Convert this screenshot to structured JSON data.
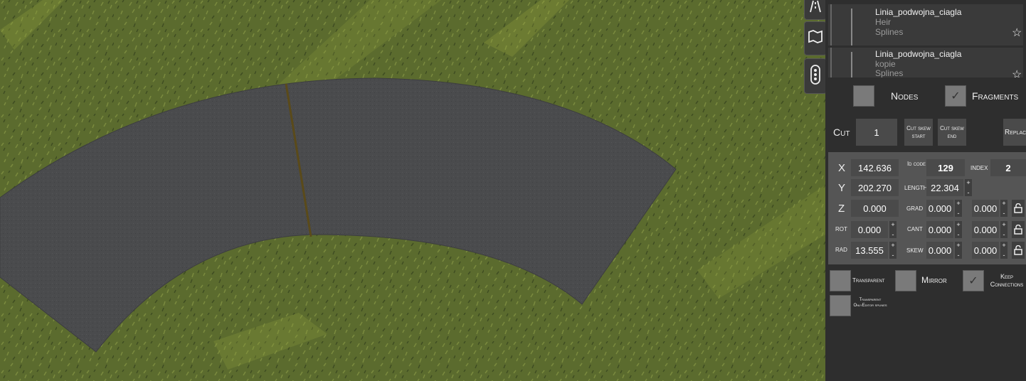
{
  "colors": {
    "asphalt": "#4a4b4d",
    "grass": "#5f6e30",
    "panel": "#2e2e2e",
    "field": "#4a4a4a",
    "center_line": "#5a4a1a"
  },
  "list": [
    {
      "title": "Linia_podwojna_ciagla",
      "sub1": "Heir",
      "sub2": "Splines"
    },
    {
      "title": "Linia_podwojna_ciagla",
      "sub1": "kopie",
      "sub2": "Splines"
    }
  ],
  "side_tools": [
    "road-icon",
    "map-flag-icon",
    "traffic-light-icon"
  ],
  "toggles": {
    "nodes": "Nodes",
    "fragments": "Fragments",
    "nodes_checked": false,
    "fragments_checked": true
  },
  "cut": {
    "label": "Cut",
    "value": "1",
    "skew_start": "Cut skew start",
    "skew_end": "Cut skew end",
    "replace": "Replac"
  },
  "props": {
    "x_label": "X",
    "x": "142.636",
    "y_label": "Y",
    "y": "202.270",
    "z_label": "Z",
    "z": "0.000",
    "rot_label": "ROT",
    "rot": "0.000",
    "rad_label": "RAD",
    "rad": "13.555",
    "id_label": "Id code",
    "id": "129",
    "index_label": "INDEX",
    "index": "2",
    "length_label": "LENGTH",
    "length": "22.304",
    "grad_label": "GRAD",
    "grad1": "0.000",
    "grad2": "0.000",
    "cant_label": "CANT",
    "cant1": "0.000",
    "cant2": "0.000",
    "skew_label": "SKEW",
    "skew1": "0.000",
    "skew2": "0.000"
  },
  "options": {
    "transparent": "Transparent",
    "mirror": "Mirror",
    "keep": "Keep Connections",
    "transparent_only": "Transparent OnlyEditor splines",
    "keep_checked": true
  }
}
